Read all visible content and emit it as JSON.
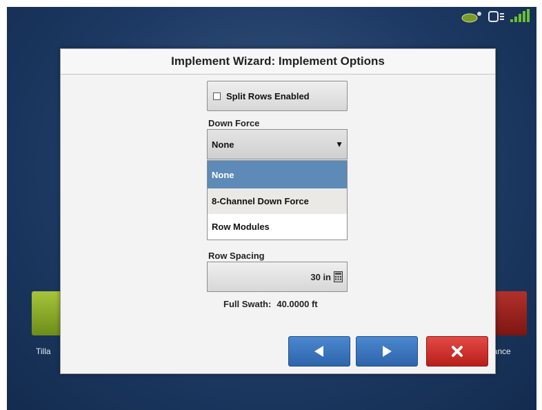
{
  "dialog": {
    "title": "Implement Wizard: Implement Options"
  },
  "split_rows": {
    "label": "Split Rows Enabled",
    "checked": false
  },
  "down_force": {
    "label": "Down Force",
    "selected": "None",
    "options": [
      "None",
      "8-Channel Down Force",
      "Row Modules"
    ]
  },
  "row_spacing": {
    "label": "Row Spacing",
    "value": "30 in"
  },
  "full_swath": {
    "label": "Full Swath:",
    "value": "40.0000 ft"
  },
  "background": {
    "left_tile_label": "Tilla",
    "right_tile_label": "dance"
  },
  "icons": {
    "status": [
      "gps-antenna-icon",
      "display-icon",
      "wifi-signal-icon"
    ],
    "prev": "arrow-left-icon",
    "next": "arrow-right-icon",
    "cancel": "close-icon",
    "calculator": "calculator-icon"
  },
  "colors": {
    "nav_blue": "#3a74bd",
    "cancel_red": "#cf322d",
    "selected_option": "#5d8ab7"
  }
}
